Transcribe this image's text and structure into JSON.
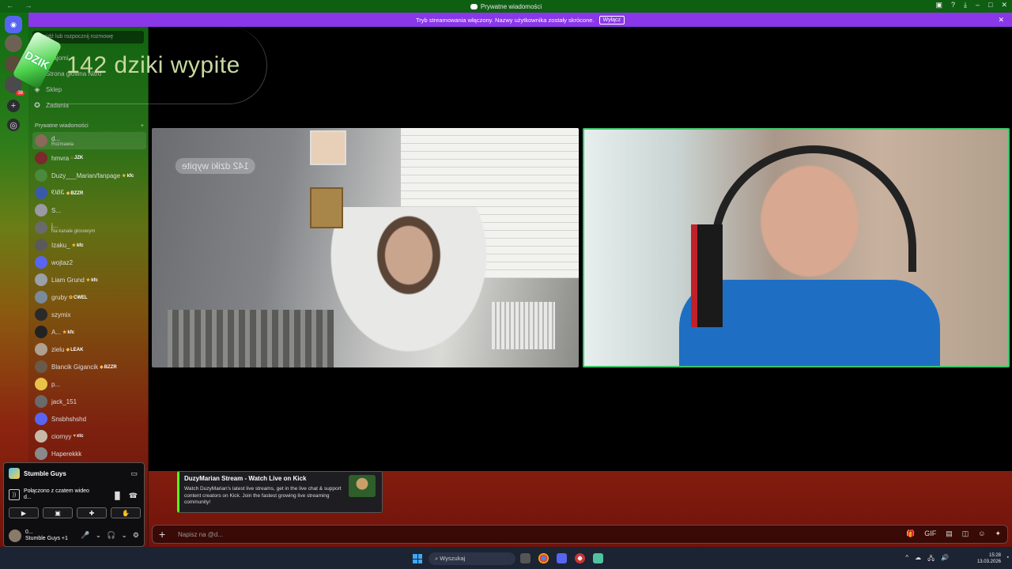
{
  "window": {
    "title": "Prywatne wiadomości",
    "nav": "← →",
    "controls": [
      "▣",
      "?",
      "⤓",
      "–",
      "□",
      "✕"
    ]
  },
  "banner": {
    "text": "Tryb streamowania włączony. Nazwy użytkownika zostały skrócone.",
    "button": "Wyłącz",
    "close": "✕"
  },
  "rail": {
    "add_label": "+",
    "explore_label": "◎",
    "badge": "38"
  },
  "overlay": {
    "counter": "142  dziki wypite",
    "can_label": "DZIK"
  },
  "sidebar": {
    "search_placeholder": "Znajdź lub rozpocznij rozmowę",
    "nav": [
      {
        "label": "Znajomi",
        "icon": "friends-icon",
        "glyph": "☺"
      },
      {
        "label": "Strona główna Nitro",
        "icon": "nitro-icon",
        "glyph": "◉"
      },
      {
        "label": "Sklep",
        "icon": "shop-icon",
        "glyph": "◈"
      },
      {
        "label": "Zadania",
        "icon": "quests-icon",
        "glyph": "✪"
      }
    ],
    "dm_header": "Prywatne wiadomości",
    "dm_add": "+",
    "dms": [
      {
        "name": "d...",
        "sub": "Rozmawia",
        "color": "#8a6a5a",
        "active": true
      },
      {
        "name": "hmvra",
        "tag": "JZK",
        "tag_icon": "⌂",
        "color": "#7a2a2a"
      },
      {
        "name": "Duzy___Marian/fanpage",
        "tag": "kfc",
        "tag_icon": "★",
        "color": "#4a8a3a"
      },
      {
        "name": "ᎧᏰᏋ",
        "tag": "BZZR",
        "tag_icon": "◆",
        "color": "#3a5aa8"
      },
      {
        "name": "S...",
        "color": "#9a9aa2"
      },
      {
        "name": "j...",
        "sub": "Na kanale głosowym",
        "color": "#6a6a6a"
      },
      {
        "name": "Izaku_",
        "tag": "kfc",
        "tag_icon": "★",
        "color": "#5a5a5a"
      },
      {
        "name": "wojtaz2",
        "color": "#5865f2"
      },
      {
        "name": "Liam Grund",
        "tag": "kfc",
        "tag_icon": "★",
        "color": "#9aa0a8"
      },
      {
        "name": "gruby",
        "tag": "CWEL",
        "tag_icon": "✿",
        "color": "#7a8a9a"
      },
      {
        "name": "szymix",
        "color": "#2a2a2a"
      },
      {
        "name": "A...",
        "tag": "kfc",
        "tag_icon": "★",
        "color": "#222"
      },
      {
        "name": "zielu",
        "tag": "LEAK",
        "tag_icon": "◆",
        "color": "#b0a090"
      },
      {
        "name": "Blancik Gigancik",
        "tag": "BZZR",
        "tag_icon": "◆",
        "color": "#6a5a4a"
      },
      {
        "name": "p...",
        "color": "#e8c24a"
      },
      {
        "name": "jack_151",
        "color": "#6a6a6a"
      },
      {
        "name": "Snsbhshshd",
        "color": "#5865f2"
      },
      {
        "name": "ciornyy",
        "tag": "xtc",
        "tag_icon": "♥",
        "color": "#c8b8a8"
      },
      {
        "name": "Haperekkk",
        "color": "#8a8a8a"
      }
    ]
  },
  "user_panel": {
    "game": "Stumble Guys",
    "game_action": "▭",
    "connection": "Połączono z czatem wideo",
    "connection_sub": "d...",
    "conn_icons": [
      "▐▌",
      "☎"
    ],
    "buttons": [
      "▶",
      "▣",
      "✚",
      "✋"
    ],
    "user_name": "0...",
    "user_status": "Stumble Guys +1",
    "user_ctrls": [
      "🎤",
      "⌄",
      "🎧",
      "⌄",
      "⚙"
    ]
  },
  "stage": {
    "left_overlay_text": "142  dziki wypite"
  },
  "embed": {
    "title": "DuzyMarian Stream - Watch Live on Kick",
    "description": "Watch DuzyMarian's latest live streams, get in the live chat & support content creators on Kick. Join the fastest growing live streaming community!"
  },
  "composer": {
    "plus": "+",
    "placeholder": "Napisz na @d...",
    "icons": [
      "🎁",
      "GIF",
      "▤",
      "◫",
      "☺",
      "✦"
    ]
  },
  "taskbar": {
    "search": "Wyszukaj",
    "tray": [
      "^",
      "☁",
      "🖧",
      "🔊"
    ],
    "time": "15:28",
    "date": "13.03.2026",
    "corner": "▪"
  },
  "colors": {
    "banner": "#8a36e9",
    "discord_blurple": "#5865f2",
    "speaking_border": "#3fc36a",
    "kick_green": "#53fc18"
  }
}
